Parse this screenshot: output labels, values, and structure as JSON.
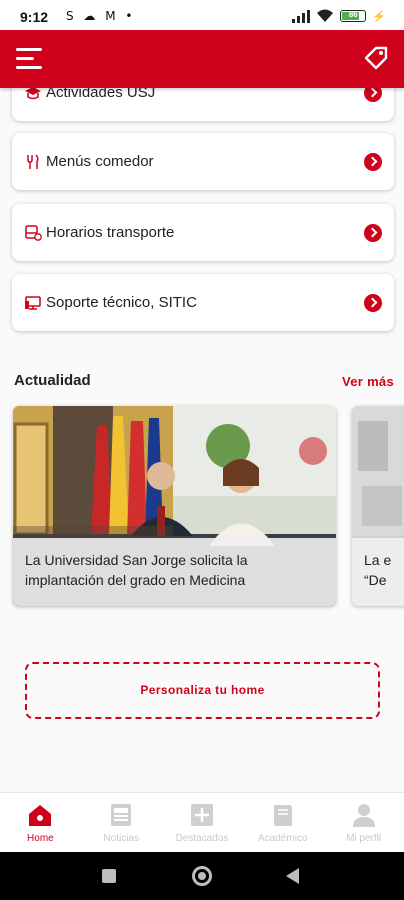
{
  "status_bar": {
    "time": "9:12",
    "left_icons": "S ☁ M •",
    "battery_level": "86"
  },
  "app_bar": {
    "menu_icon": "hamburger-menu-icon",
    "right_icon": "tag-icon",
    "brand_color": "#d0021b"
  },
  "quick_links": [
    {
      "label": "Actividades USJ",
      "icon": "graduation-cap-icon"
    },
    {
      "label": "Menús comedor",
      "icon": "fork-knife-icon"
    },
    {
      "label": "Horarios transporte",
      "icon": "bus-schedule-icon"
    },
    {
      "label": "Soporte técnico, SITIC",
      "icon": "computer-support-icon"
    }
  ],
  "news": {
    "title": "Actualidad",
    "see_more": "Ver más",
    "items": [
      {
        "caption": "La Universidad San Jorge solicita la implantación del grado en Medicina"
      },
      {
        "caption": "La e\n“De"
      }
    ]
  },
  "personalize_button": "Personaliza tu home",
  "bottom_nav": [
    {
      "label": "Home",
      "icon": "home-icon",
      "active": true
    },
    {
      "label": "Noticias",
      "icon": "news-icon",
      "active": false
    },
    {
      "label": "Destacados",
      "icon": "plus-square-icon",
      "active": false
    },
    {
      "label": "Académico",
      "icon": "book-icon",
      "active": false
    },
    {
      "label": "Mi perfil",
      "icon": "user-icon",
      "active": false
    }
  ]
}
